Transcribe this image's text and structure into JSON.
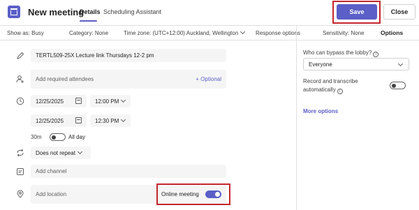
{
  "header": {
    "title": "New meeting",
    "tabs": [
      {
        "label": "Details",
        "active": true
      },
      {
        "label": "Scheduling Assistant",
        "active": false
      }
    ],
    "save_label": "Save",
    "close_label": "Close"
  },
  "subbar": {
    "show_as": "Show as: Busy",
    "category": "Category: None",
    "time_zone": "Time zone: (UTC+12:00) Auckland, Wellington",
    "response_options": "Response options",
    "sensitivity": "Sensitivity: None",
    "options_tab": "Options"
  },
  "form": {
    "title_value": "TERTL509-25X Lecture link Thursdays 12-2 pm",
    "attendees_placeholder": "Add required attendees",
    "optional_label": "+ Optional",
    "start_date": "12/25/2025",
    "start_time": "12:00 PM",
    "end_date": "12/25/2025",
    "end_time": "12:30 PM",
    "duration": "30m",
    "all_day_label": "All day",
    "all_day_on": false,
    "repeat": "Does not repeat",
    "channel_placeholder": "Add channel",
    "location_placeholder": "Add location",
    "online_meeting_label": "Online meeting",
    "online_meeting_on": true
  },
  "options_panel": {
    "lobby_label": "Who can bypass the lobby?",
    "lobby_value": "Everyone",
    "record_label_line1": "Record and transcribe",
    "record_label_line2": "automatically",
    "record_on": false,
    "more_options": "More options"
  },
  "colors": {
    "accent": "#5b5fc7",
    "highlight": "#c4262e"
  }
}
